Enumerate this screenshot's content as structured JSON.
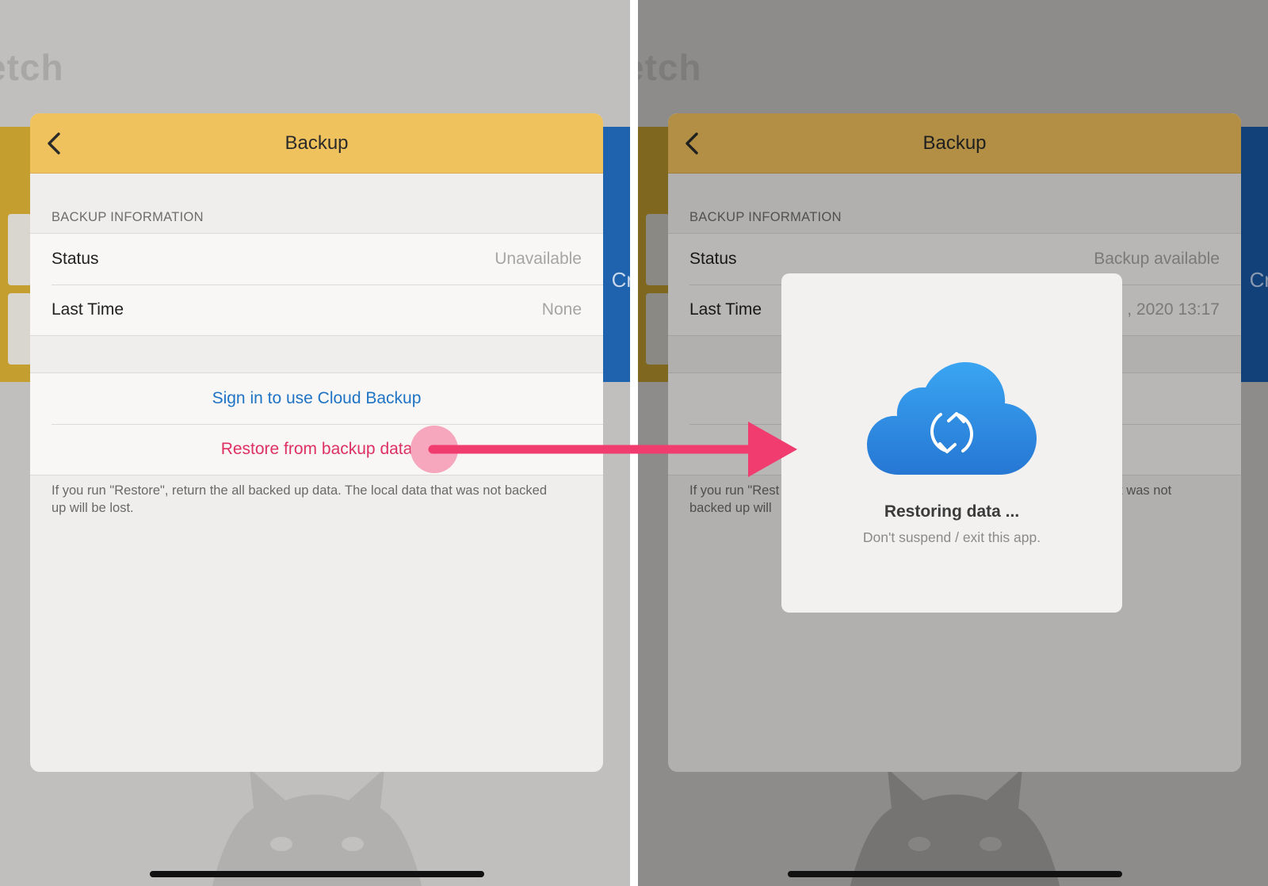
{
  "background": {
    "title_fragment_left": "etch",
    "title_fragment_right": "etch",
    "side_label": "Cr"
  },
  "left": {
    "nav": {
      "title": "Backup",
      "back_icon": "chevron-left-icon"
    },
    "section_header": "BACKUP INFORMATION",
    "rows": [
      {
        "label": "Status",
        "value": "Unavailable"
      },
      {
        "label": "Last Time",
        "value": "None"
      }
    ],
    "actions": {
      "sign_in": "Sign in to use Cloud Backup",
      "restore": "Restore from backup data"
    },
    "footnote": "If you run \"Restore\", return the all backed up data. The local data that was not backed up will be lost."
  },
  "right": {
    "nav": {
      "title": "Backup",
      "back_icon": "chevron-left-icon"
    },
    "section_header": "BACKUP INFORMATION",
    "rows": [
      {
        "label": "Status",
        "value": "Backup available"
      },
      {
        "label": "Last Time",
        "value": ", 2020 13:17"
      }
    ],
    "footnote_fragments": {
      "left_line1": "If you run \"Rest",
      "left_line2": "backed up will",
      "right_line1": "at was not"
    },
    "modal": {
      "icon": "cloud-sync-icon",
      "title": "Restoring data ...",
      "subtitle": "Don't suspend / exit this app."
    }
  },
  "colors": {
    "nav_yellow": "#f0c25d",
    "link_blue": "#1f73c4",
    "destructive_red": "#de3062",
    "arrow_pink": "#f03c6e",
    "cloud_blue": "#2f8fe4"
  }
}
